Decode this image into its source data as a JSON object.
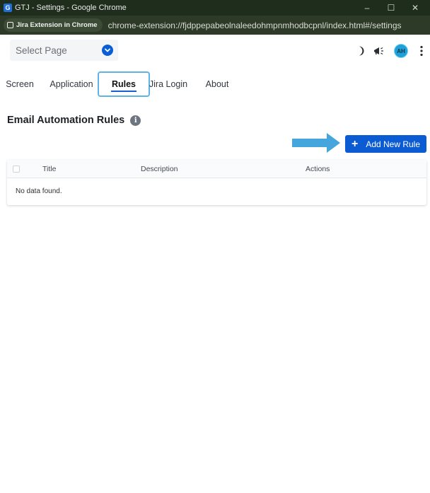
{
  "window": {
    "title": "GTJ - Settings - Google Chrome",
    "app_icon_letter": "G",
    "controls": {
      "minimize": "–",
      "maximize": "☐",
      "close": "✕"
    }
  },
  "addressbar": {
    "extension_label": "Jira Extension in Chrome",
    "url": "chrome-extension://fjdppepabeolnaleedohmpnmhodbcpnl/index.html#/settings"
  },
  "topbar": {
    "select_page_placeholder": "Select Page",
    "avatar_initials": "AH",
    "icons": [
      "moon-icon",
      "megaphone-icon",
      "avatar",
      "more-vertical-icon"
    ]
  },
  "tabs": [
    {
      "label": "Screen",
      "active": false
    },
    {
      "label": "Application",
      "active": false
    },
    {
      "label": "Rules",
      "active": true
    },
    {
      "label": "Jira Login",
      "active": false
    },
    {
      "label": "About",
      "active": false
    }
  ],
  "section": {
    "title": "Email Automation Rules",
    "info_glyph": "i"
  },
  "actions": {
    "add_button_label": "Add New Rule",
    "add_button_icon": "+"
  },
  "table": {
    "columns": [
      "Title",
      "Description",
      "Actions"
    ],
    "empty_message": "No data found."
  },
  "colors": {
    "accent": "#0b5bd3",
    "tab_highlight": "#60b4e4",
    "annotation_arrow": "#44a6dc",
    "titlebar": "#1f2d1c"
  }
}
